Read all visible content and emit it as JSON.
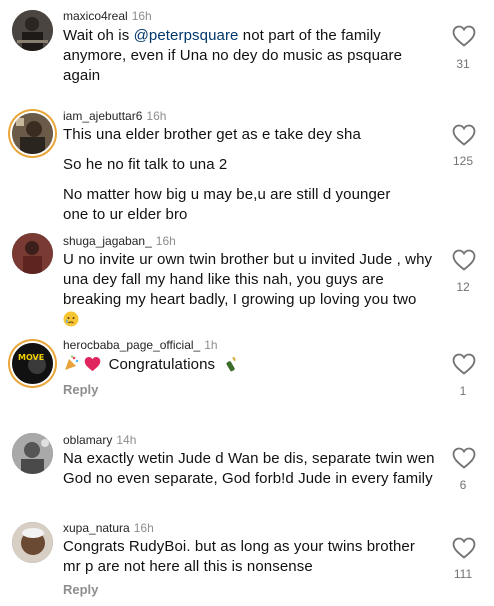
{
  "comments": [
    {
      "username": "maxico4real",
      "time": "16h",
      "lines": [
        "Wait oh is ",
        "@peterpsquare",
        " not part of the family anymore, even if Una no dey do music as psquare again"
      ],
      "likes": "31"
    },
    {
      "username": "iam_ajebuttar6",
      "time": "16h",
      "paragraphs": [
        "This una elder brother get as e take dey sha",
        "So he no fit talk to una 2",
        "No matter how big u may be,u are still d younger one to ur elder bro"
      ],
      "likes": "125"
    },
    {
      "username": "shuga_jagaban_",
      "time": "16h",
      "text": "U no invite ur own twin brother but u invited Jude , why una dey fall my hand like this nah, you guys are breaking my heart badly, I growing up loving you two",
      "likes": "12"
    },
    {
      "username": "herocbaba_page_official_",
      "time": "1h",
      "text": "Congratulations",
      "reply": "Reply",
      "likes": "1"
    },
    {
      "username": "oblamary",
      "time": "14h",
      "text": "Na exactly wetin Jude d Wan be dis, separate twin wen God no even separate, God forb!d Jude in every family",
      "likes": "6"
    },
    {
      "username": "xupa_natura",
      "time": "16h",
      "text": "Congrats RudyBoi. but as long as your twins brother mr p are not here all  this is nonsense",
      "reply": "Reply",
      "likes": "111"
    }
  ]
}
